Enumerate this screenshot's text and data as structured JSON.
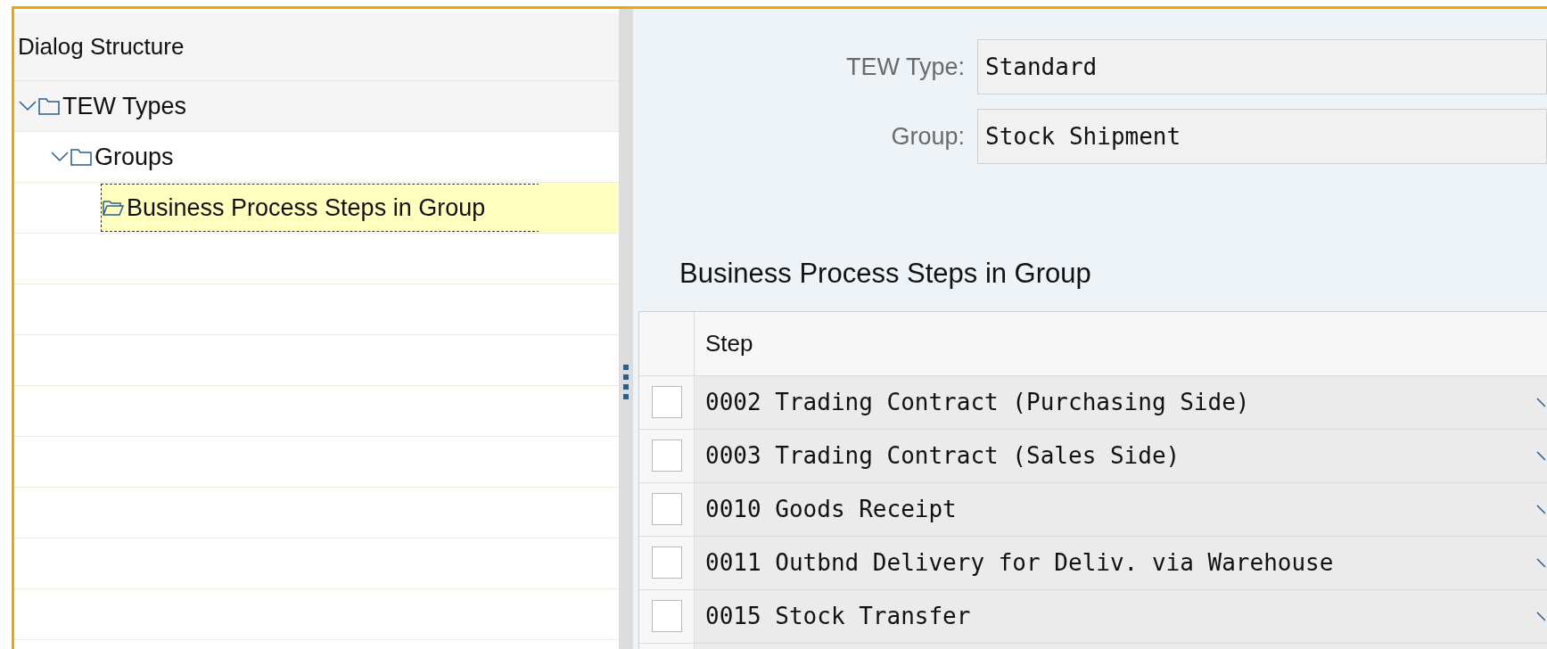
{
  "dialog_structure": {
    "title": "Dialog Structure",
    "tree": [
      {
        "label": "TEW Types",
        "expanded": true,
        "selected": false,
        "children": [
          {
            "label": "Groups",
            "expanded": true,
            "selected": false,
            "children": [
              {
                "label": "Business Process Steps in Group",
                "selected": true
              }
            ]
          }
        ]
      }
    ]
  },
  "form": {
    "fields": [
      {
        "label": "TEW Type:",
        "value": "Standard"
      },
      {
        "label": "Group:",
        "value": "Stock Shipment"
      }
    ]
  },
  "table": {
    "title": "Business Process Steps in Group",
    "columns": [
      "Step"
    ],
    "rows": [
      {
        "checked": false,
        "step": "0002 Trading Contract (Purchasing Side)"
      },
      {
        "checked": false,
        "step": "0003 Trading Contract (Sales Side)"
      },
      {
        "checked": false,
        "step": "0010 Goods Receipt"
      },
      {
        "checked": false,
        "step": "0011 Outbnd Delivery for Deliv. via Warehouse"
      },
      {
        "checked": false,
        "step": "0015 Stock Transfer"
      }
    ]
  }
}
